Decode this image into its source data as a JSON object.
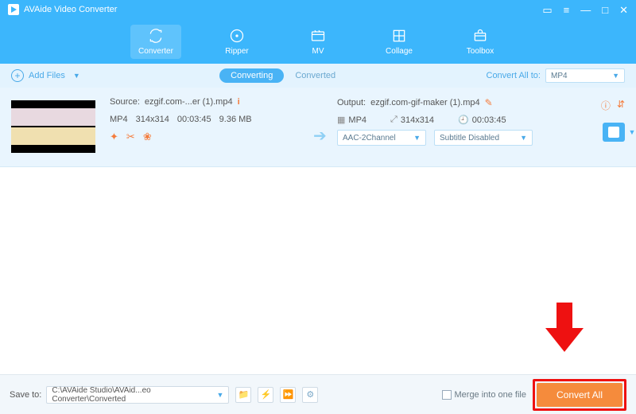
{
  "title": "AVAide Video Converter",
  "tabs": [
    {
      "label": "Converter"
    },
    {
      "label": "Ripper"
    },
    {
      "label": "MV"
    },
    {
      "label": "Collage"
    },
    {
      "label": "Toolbox"
    }
  ],
  "addFiles": "Add Files",
  "subtabs": {
    "converting": "Converting",
    "converted": "Converted"
  },
  "convertAllToLabel": "Convert All to:",
  "convertAllToValue": "MP4",
  "source": {
    "label": "Source:",
    "name": "ezgif.com-...er (1).mp4",
    "format": "MP4",
    "dims": "314x314",
    "dur": "00:03:45",
    "size": "9.36 MB"
  },
  "output": {
    "label": "Output:",
    "name": "ezgif.com-gif-maker (1).mp4",
    "format": "MP4",
    "dims": "314x314",
    "dur": "00:03:45",
    "audio": "AAC-2Channel",
    "subtitle": "Subtitle Disabled"
  },
  "footer": {
    "saveTo": "Save to:",
    "path": "C:\\AVAide Studio\\AVAid...eo Converter\\Converted",
    "merge": "Merge into one file",
    "convertAll": "Convert All"
  }
}
